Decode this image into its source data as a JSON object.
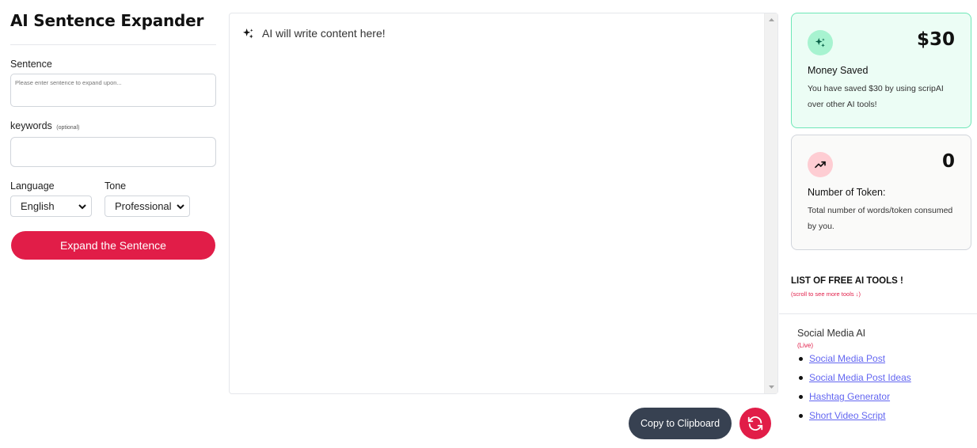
{
  "app": {
    "title": "AI Sentence Expander"
  },
  "form": {
    "sentence_label": "Sentence",
    "sentence_placeholder": "Please enter sentence to expand upon...",
    "sentence_value": "",
    "keywords_label": "keywords",
    "keywords_optional": "(optional)",
    "keywords_value": "",
    "language_label": "Language",
    "language_value": "English",
    "tone_label": "Tone",
    "tone_value": "Professional",
    "submit_label": "Expand the Sentence"
  },
  "output": {
    "placeholder": "AI will write content here!",
    "copy_label": "Copy to Clipboard"
  },
  "stats": {
    "money": {
      "value": "$30",
      "title": "Money Saved",
      "desc": "You have saved $30 by using scripAI over other AI tools!"
    },
    "tokens": {
      "value": "0",
      "title": "Number of Token:",
      "desc": "Total number of words/token consumed by you."
    }
  },
  "tools": {
    "heading": "LIST OF FREE AI TOOLS !",
    "hint": "(scroll to see more tools ↓)",
    "category": "Social Media AI",
    "status": "(Live)",
    "items": [
      "Social Media Post",
      "Social Media Post Ideas",
      "Hashtag Generator",
      "Short Video Script"
    ]
  },
  "colors": {
    "accent": "#e11d48",
    "dark_button": "#374151",
    "success_bg": "#ecfdf5",
    "success_border": "#6ee7b7",
    "link": "#6366f1"
  }
}
